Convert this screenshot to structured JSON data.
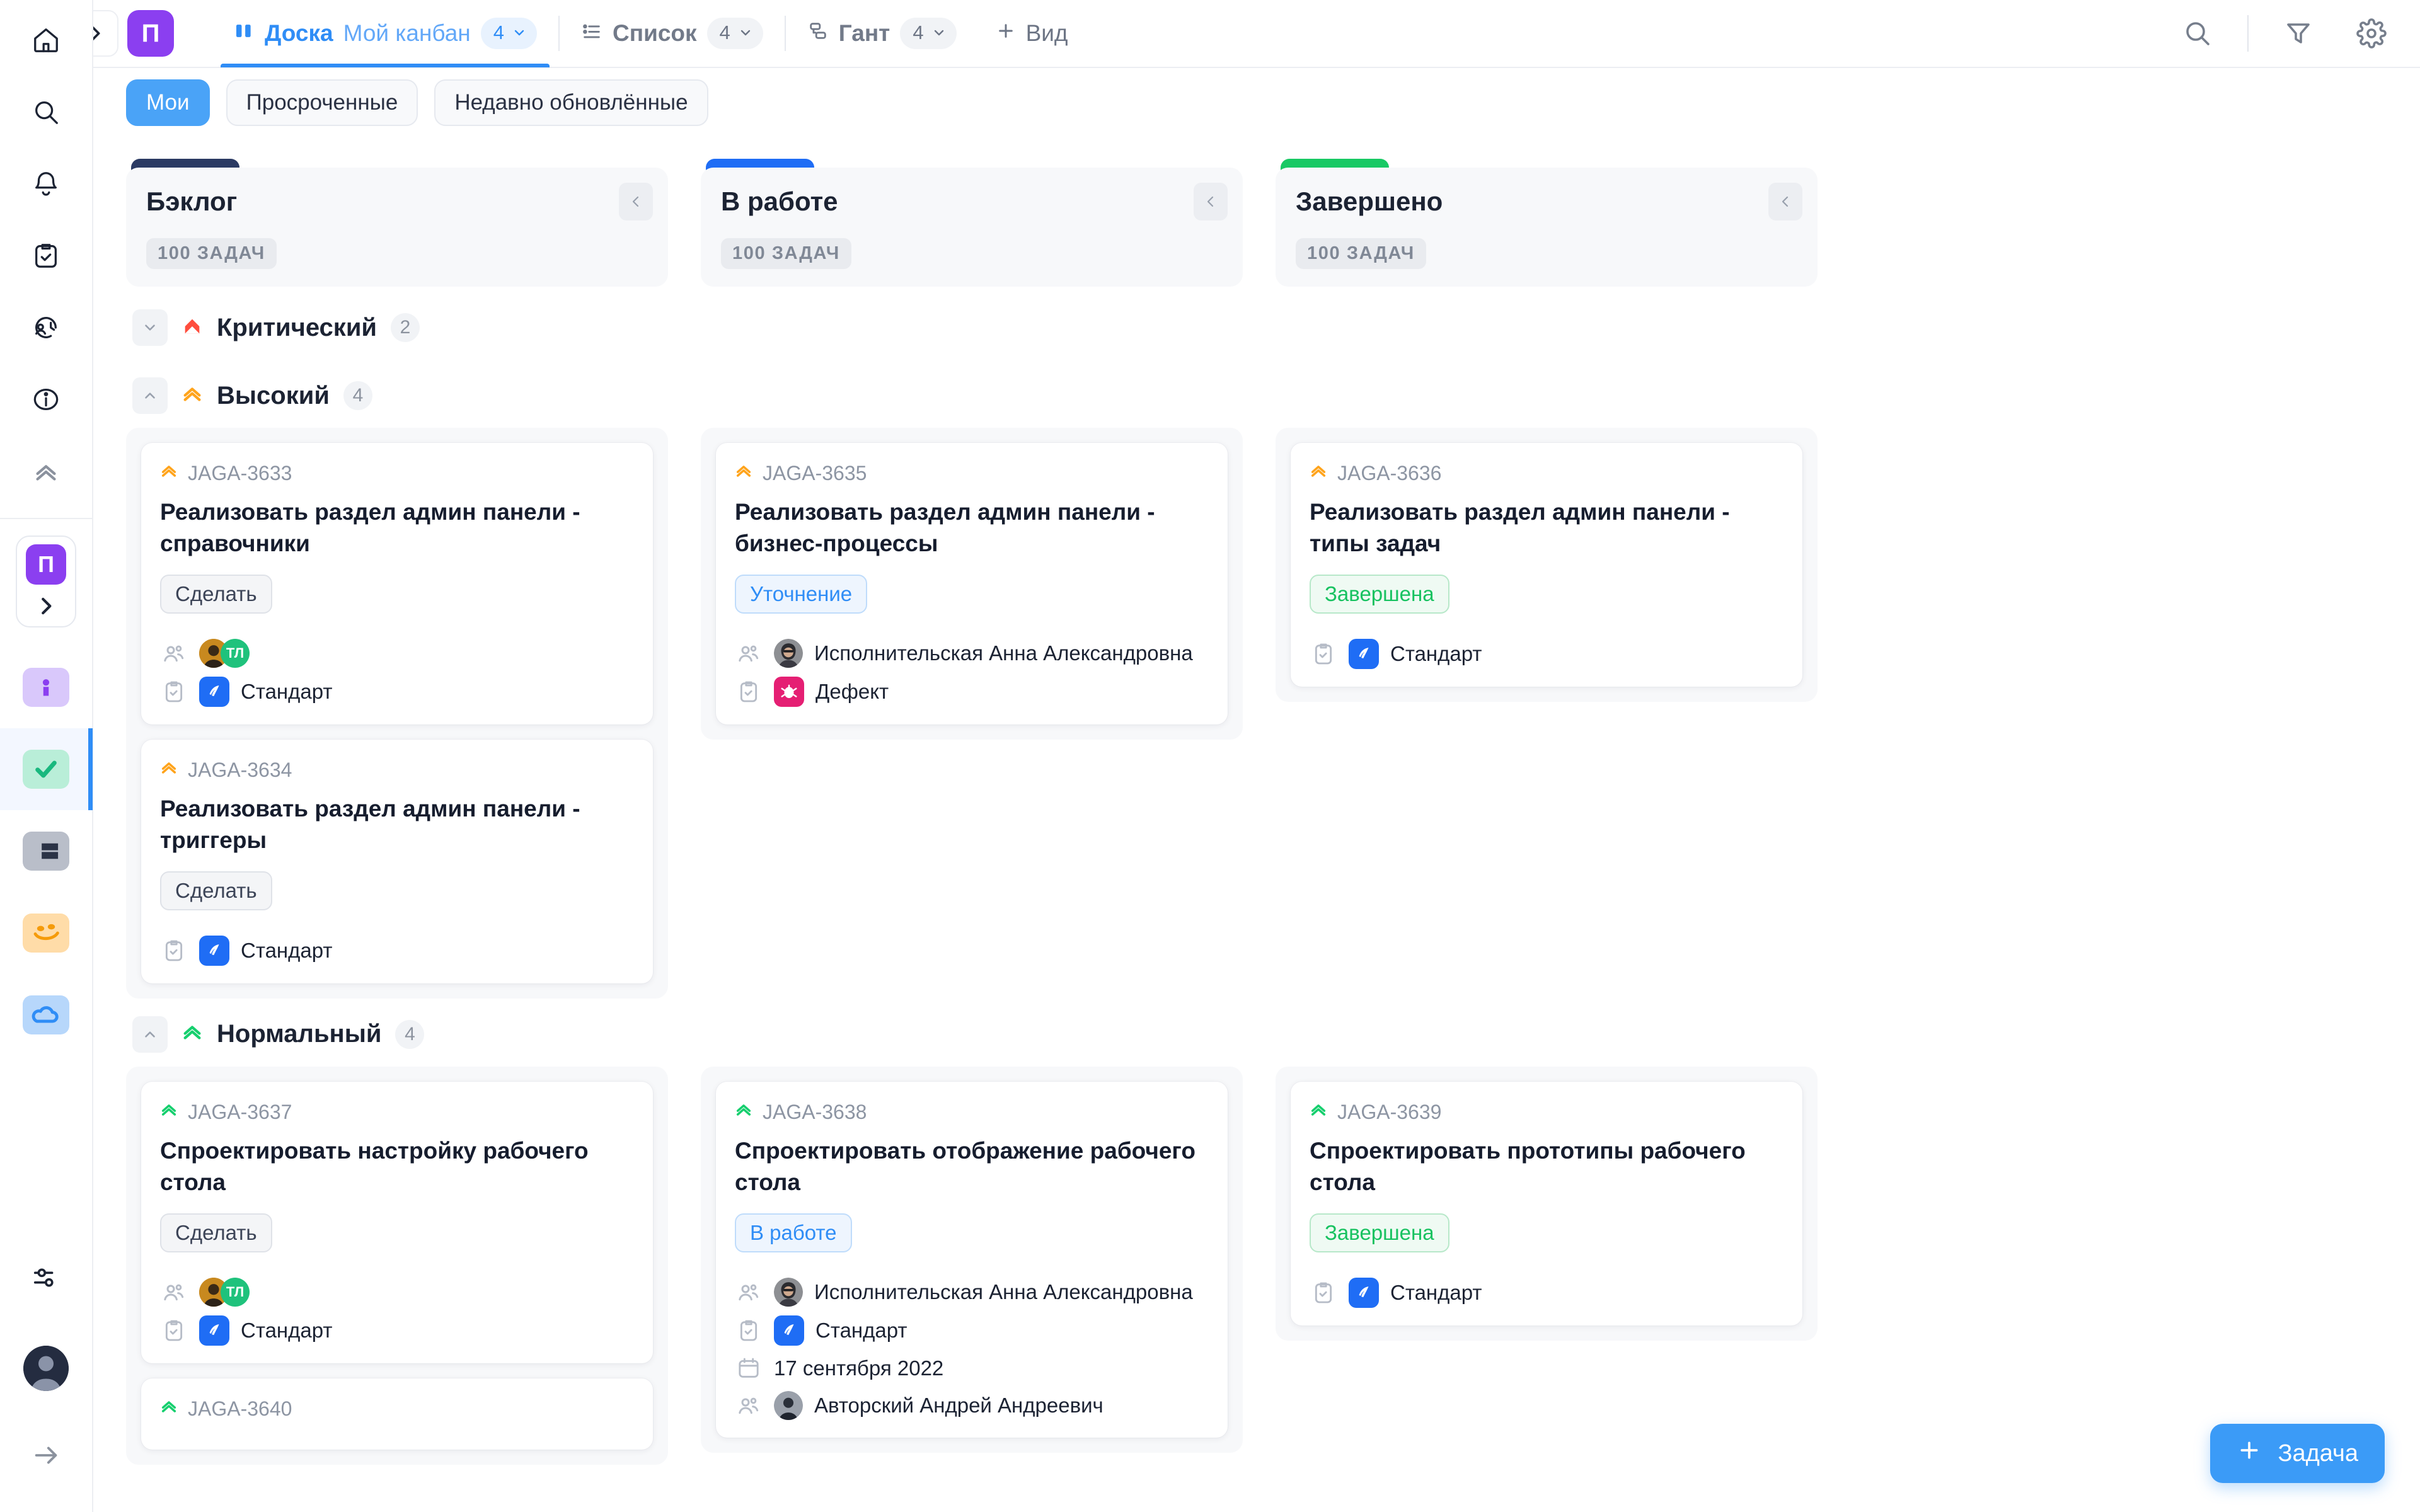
{
  "rail": {
    "top_icons": [
      {
        "name": "home-icon"
      },
      {
        "name": "search-icon"
      },
      {
        "name": "bell-icon"
      },
      {
        "name": "tasks-clipboard-icon"
      },
      {
        "name": "time-tracking-icon"
      },
      {
        "name": "info-icon"
      },
      {
        "name": "priority-chevrons-icon"
      }
    ],
    "project_badge": "П",
    "apps": [
      {
        "name": "app-tile-info",
        "color": "#d9c8fb"
      },
      {
        "name": "app-tile-tasks",
        "color": "#b9eed8",
        "active": true
      },
      {
        "name": "app-tile-board",
        "color": "#b9bec9"
      },
      {
        "name": "app-tile-chat",
        "color": "#ffdca8"
      },
      {
        "name": "app-tile-cloud",
        "color": "#b7d7fb"
      }
    ],
    "bottom_icons": [
      {
        "name": "settings-sliders-icon"
      },
      {
        "name": "user-avatar"
      },
      {
        "name": "collapse-arrow-icon"
      }
    ]
  },
  "topbar": {
    "project_initial": "П",
    "tabs": [
      {
        "name": "Доска",
        "subtitle": "Мой канбан",
        "count": "4",
        "icon": "board-icon",
        "active": true
      },
      {
        "name": "Список",
        "subtitle": "",
        "count": "4",
        "icon": "list-icon",
        "active": false
      },
      {
        "name": "Гант",
        "subtitle": "",
        "count": "4",
        "icon": "gantt-icon",
        "active": false
      }
    ],
    "add_view_label": "Вид",
    "icons": [
      {
        "name": "search-icon"
      },
      {
        "name": "filter-icon"
      },
      {
        "name": "gear-icon"
      }
    ]
  },
  "filters": [
    {
      "label": "Мои",
      "selected": true
    },
    {
      "label": "Просроченные",
      "selected": false
    },
    {
      "label": "Недавно обновлённые",
      "selected": false
    }
  ],
  "columns": [
    {
      "title": "Бэклог",
      "count_label": "100 ЗАДАЧ",
      "accent": "#2b3a63"
    },
    {
      "title": "В работе",
      "count_label": "100 ЗАДАЧ",
      "accent": "#1f6df5"
    },
    {
      "title": "Завершено",
      "count_label": "100 ЗАДАЧ",
      "accent": "#18c964"
    }
  ],
  "groups": [
    {
      "name": "Критический",
      "count": "2",
      "priority_color": "#ff4d3d",
      "priority_icon": "priority-critical-icon",
      "expanded": false,
      "cards": [
        [],
        [],
        []
      ]
    },
    {
      "name": "Высокий",
      "count": "4",
      "priority_color": "#ffa41c",
      "priority_icon": "priority-high-icon",
      "expanded": true,
      "cards": [
        [
          {
            "key": "JAGA-3633",
            "title": "Реализовать раздел админ панели - справочники",
            "status": "Сделать",
            "status_kind": "todo",
            "assignees": [
              "photo",
              "ТЛ"
            ],
            "type": "Стандарт",
            "type_kind": "standard"
          },
          {
            "key": "JAGA-3634",
            "title": "Реализовать раздел админ панели - триггеры",
            "status": "Сделать",
            "status_kind": "todo",
            "assignees": [],
            "type": "Стандарт",
            "type_kind": "standard"
          }
        ],
        [
          {
            "key": "JAGA-3635",
            "title": "Реализовать раздел админ панели - бизнес-процессы",
            "status": "Уточнение",
            "status_kind": "prog",
            "assignee_name": "Исполнительская Анна Александровна",
            "type": "Дефект",
            "type_kind": "defect"
          }
        ],
        [
          {
            "key": "JAGA-3636",
            "title": "Реализовать раздел админ панели - типы задач",
            "status": "Завершена",
            "status_kind": "done",
            "type": "Стандарт",
            "type_kind": "standard"
          }
        ]
      ]
    },
    {
      "name": "Нормальный",
      "count": "4",
      "priority_color": "#16cf6e",
      "priority_icon": "priority-normal-icon",
      "expanded": true,
      "cards": [
        [
          {
            "key": "JAGA-3637",
            "title": "Спроектировать настройку рабочего стола",
            "status": "Сделать",
            "status_kind": "todo",
            "assignees": [
              "photo",
              "ТЛ"
            ],
            "type": "Стандарт",
            "type_kind": "standard"
          },
          {
            "key": "JAGA-3640",
            "title": "",
            "status": "",
            "status_kind": "",
            "type": "",
            "type_kind": ""
          }
        ],
        [
          {
            "key": "JAGA-3638",
            "title": "Спроектировать отображение рабочего стола",
            "status": "В работе",
            "status_kind": "prog",
            "assignee_name": "Исполнительская Анна Александровна",
            "type": "Стандарт",
            "type_kind": "standard",
            "date": "17 сентября 2022",
            "author_name": "Авторский Андрей Андреевич"
          }
        ],
        [
          {
            "key": "JAGA-3639",
            "title": "Спроектировать прототипы рабочего стола",
            "status": "Завершена",
            "status_kind": "done",
            "type": "Стандарт",
            "type_kind": "standard"
          }
        ]
      ]
    }
  ],
  "fab": {
    "label": "Задача",
    "icon": "plus-icon",
    "color": "#3b9bf7"
  }
}
